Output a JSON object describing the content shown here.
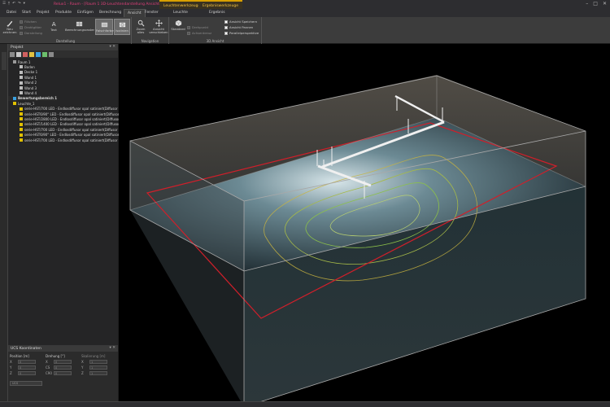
{
  "titlebar": {
    "quick_access": [
      "☰",
      "⤒",
      "↶",
      "↷",
      "▾"
    ],
    "title": "Relux1 - Raum - [Raum 1 3D-Leuchtendarstellung Ansicht von oben]",
    "context_tab_1": "Leuchtenwerkzeuge",
    "context_tab_2": "Ergebniswerkzeuge",
    "window_controls": [
      "–",
      "□",
      "✕"
    ]
  },
  "tabs": [
    "Datei",
    "Start",
    "Projekt",
    "Produkte",
    "Einfügen",
    "Berechnung",
    "Ansicht",
    "Fenster",
    "Leuchte",
    "Ergebnis"
  ],
  "active_tab": "Ansicht",
  "ribbon": {
    "group_darstellung": {
      "label": "Darstellung",
      "new_draw": "Neu zeichnen",
      "small_items": [
        "Flächen",
        "Drahtgitter",
        "Darstellung"
      ],
      "text_btn": "Text",
      "calc_btn": "Berechnungsraster",
      "color_btn": "Falschfarben",
      "iso_btn": "Isolinien"
    },
    "group_navigation": {
      "label": "Navigation",
      "zoom": "Zoom alles",
      "view_move": "Ansicht verschieben"
    },
    "group_3d": {
      "label": "3D Ansicht",
      "standard": "Standard",
      "small_items": [
        "Drehpunkt",
        "Achsenkreuz"
      ],
      "checkboxes": [
        "Ansicht Speichern",
        "Ansicht Pannen",
        "Parallelperspektive"
      ]
    }
  },
  "left_panel": {
    "title": "Projekt",
    "controls": "▾ ✕",
    "tree": [
      {
        "label": "Raum 1",
        "level": 1,
        "icon": "#9a9a9a"
      },
      {
        "label": "Boden",
        "level": 2,
        "icon": "#bdbdbd"
      },
      {
        "label": "Decke 1",
        "level": 2,
        "icon": "#bdbdbd"
      },
      {
        "label": "Wand 1",
        "level": 2,
        "icon": "#bdbdbd"
      },
      {
        "label": "Wand 2",
        "level": 2,
        "icon": "#bdbdbd"
      },
      {
        "label": "Wand 3",
        "level": 2,
        "icon": "#bdbdbd"
      },
      {
        "label": "Wand 4",
        "level": 2,
        "icon": "#bdbdbd"
      },
      {
        "label": "Bewertungsbereich 1",
        "level": 1,
        "icon": "#3aa0e0",
        "bold": true
      },
      {
        "label": "Leuchte_1",
        "level": 1,
        "icon": "#e0c000"
      },
      {
        "label": "serie-HST/700 LED - Endlosdiffusor opal satiniert(Diffusor i",
        "level": 2,
        "icon": "#e0c000"
      },
      {
        "label": "serie-HST6/90° LED - Endlosdiffusor opal satiniert(Diffusor i",
        "level": 2,
        "icon": "#e0c000"
      },
      {
        "label": "serie-HST/2800 LED - Endlosdiffusor opal satiniert(Diffusor i",
        "level": 2,
        "icon": "#e0c000"
      },
      {
        "label": "serie-HST/1400 LED - Endlosdiffusor opal satiniert(Diffusor i",
        "level": 2,
        "icon": "#e0c000"
      },
      {
        "label": "serie-HST/700 LED - Endlosdiffusor opal satiniert(Diffusor i",
        "level": 2,
        "icon": "#e0c000"
      },
      {
        "label": "serie-HST6/90° LED - Endlosdiffusor opal satiniert(Diffusor i",
        "level": 2,
        "icon": "#e0c000"
      },
      {
        "label": "serie-HST/700 LED - Endlosdiffusor opal satiniert(Diffusor i",
        "level": 2,
        "icon": "#e0c000"
      }
    ]
  },
  "ucs": {
    "title": "UCS Koordinaten",
    "controls": "▾ ✕",
    "col1": {
      "header": "Position [m]",
      "rows": [
        {
          "axis": "X",
          "value": "0"
        },
        {
          "axis": "Y",
          "value": "0"
        },
        {
          "axis": "Z",
          "value": "0"
        }
      ]
    },
    "col2": {
      "header": "Drehung [°]",
      "rows": [
        {
          "axis": "X",
          "value": "0"
        },
        {
          "axis": "CS",
          "value": "0"
        },
        {
          "axis": "C90",
          "value": "0"
        }
      ]
    },
    "col3": {
      "header": "Skalierung [m]",
      "rows": [
        {
          "axis": "X",
          "value": "1"
        },
        {
          "axis": "Y",
          "value": "1"
        },
        {
          "axis": "Z",
          "value": "1"
        }
      ]
    },
    "apply": "UCS"
  },
  "colors": {
    "room_edges": "#a8a8a8",
    "eval_area": "#d01f2a",
    "isoline_green": "#8cc04a",
    "isoline_yellow": "#c8b440",
    "luminaire": "#f0f0f0",
    "accent_context": "#d8a000"
  }
}
